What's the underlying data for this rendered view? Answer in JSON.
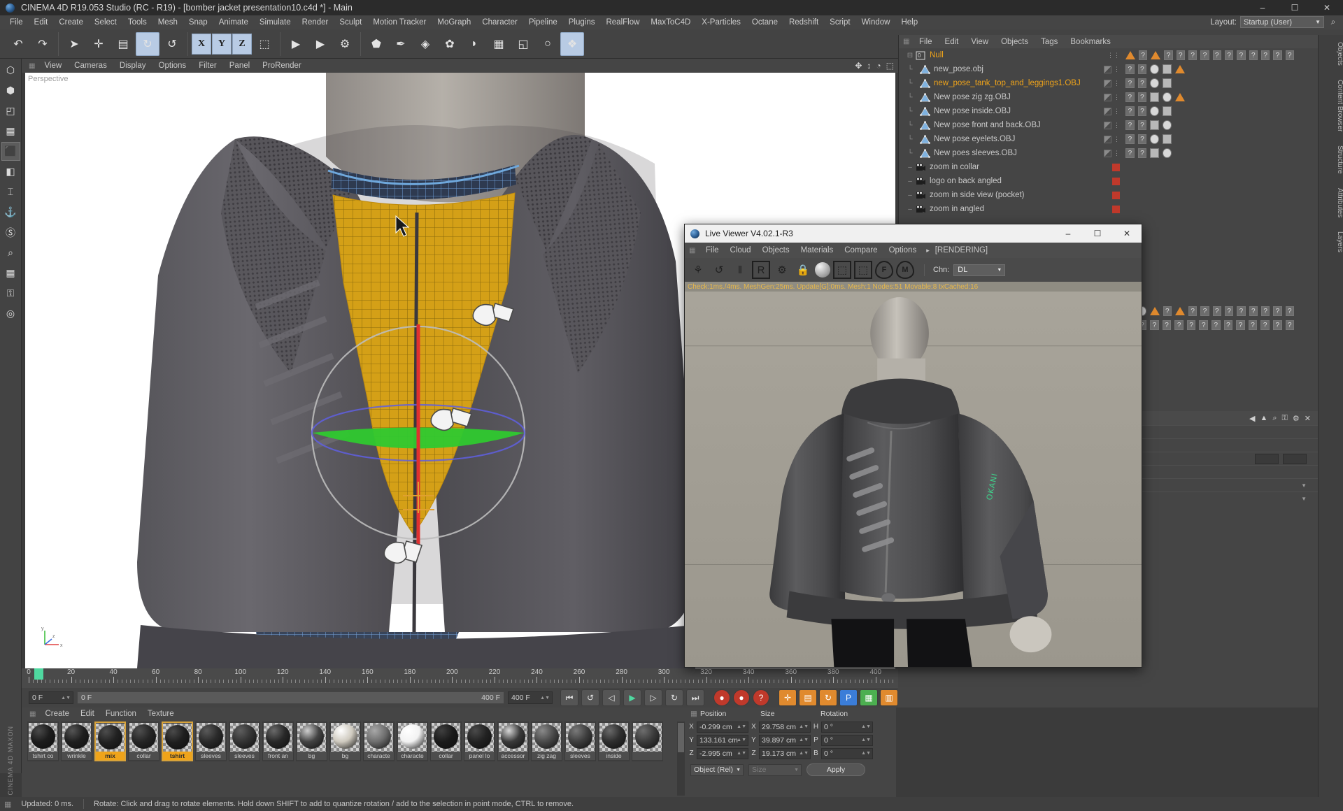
{
  "window": {
    "title": "CINEMA 4D R19.053 Studio (RC - R19) - [bomber jacket presentation10.c4d *] - Main",
    "minimize": "–",
    "maximize": "☐",
    "close": "✕"
  },
  "menubar": {
    "items": [
      "File",
      "Edit",
      "Create",
      "Select",
      "Tools",
      "Mesh",
      "Snap",
      "Animate",
      "Simulate",
      "Render",
      "Sculpt",
      "Motion Tracker",
      "MoGraph",
      "Character",
      "Pipeline",
      "Plugins",
      "RealFlow",
      "MaxToC4D",
      "X-Particles",
      "Octane",
      "Redshift",
      "Script",
      "Window",
      "Help"
    ],
    "layout_label": "Layout:",
    "layout_value": "Startup (User)",
    "search_icon": "search-icon"
  },
  "toolbar": {
    "groups": [
      {
        "name": "undo-redo",
        "buttons": [
          {
            "name": "undo-button",
            "glyph": "↶",
            "state": "off"
          },
          {
            "name": "redo-button",
            "glyph": "↷",
            "state": "off"
          }
        ]
      },
      {
        "name": "transform-tools",
        "buttons": [
          {
            "name": "select-tool",
            "glyph": "➤",
            "state": "off"
          },
          {
            "name": "move-tool",
            "glyph": "✛",
            "state": "off"
          },
          {
            "name": "scale-tool",
            "glyph": "▤",
            "state": "off"
          },
          {
            "name": "rotate-tool",
            "glyph": "↻",
            "state": "on"
          },
          {
            "name": "rotate-alt-tool",
            "glyph": "↺",
            "state": "off"
          }
        ]
      },
      {
        "name": "axis-locks",
        "buttons": [
          {
            "name": "lock-x-axis",
            "glyph": "X",
            "state": "axis"
          },
          {
            "name": "lock-y-axis",
            "glyph": "Y",
            "state": "axis"
          },
          {
            "name": "lock-z-axis",
            "glyph": "Z",
            "state": "axis"
          },
          {
            "name": "world-object-coords",
            "glyph": "⬚",
            "state": "off"
          }
        ]
      },
      {
        "name": "render-tools",
        "buttons": [
          {
            "name": "render-view-button",
            "glyph": "▶",
            "state": "off"
          },
          {
            "name": "render-region-button",
            "glyph": "▶",
            "state": "off"
          },
          {
            "name": "render-settings-button",
            "glyph": "⚙",
            "state": "off"
          }
        ]
      },
      {
        "name": "object-creation",
        "buttons": [
          {
            "name": "add-cube-button",
            "glyph": "⬟",
            "state": "off"
          },
          {
            "name": "add-spline-button",
            "glyph": "✒",
            "state": "off"
          },
          {
            "name": "add-generator-button",
            "glyph": "◈",
            "state": "off"
          },
          {
            "name": "add-deformer-button",
            "glyph": "✿",
            "state": "off"
          },
          {
            "name": "add-environment-button",
            "glyph": "◗",
            "state": "off"
          },
          {
            "name": "add-scene-button",
            "glyph": "▦",
            "state": "off"
          },
          {
            "name": "add-camera-button",
            "glyph": "◱",
            "state": "off"
          },
          {
            "name": "add-light-button",
            "glyph": "○",
            "state": "off"
          },
          {
            "name": "add-mograph-button",
            "glyph": "❖",
            "state": "on"
          }
        ]
      }
    ]
  },
  "leftbar": {
    "items": [
      {
        "name": "live-selection-tool",
        "glyph": "⬡",
        "selected": false
      },
      {
        "name": "point-mode-tool",
        "glyph": "⬢",
        "selected": false
      },
      {
        "name": "edge-mode-tool",
        "glyph": "◰",
        "selected": false
      },
      {
        "name": "polygon-mode-tool",
        "glyph": "▦",
        "selected": false
      },
      {
        "name": "model-mode-tool",
        "glyph": "⬛",
        "selected": true
      },
      {
        "name": "texture-mode-tool",
        "glyph": "◧",
        "selected": false
      },
      {
        "name": "workplane-tool",
        "glyph": "⌶",
        "selected": false
      },
      {
        "name": "axis-lock-tool",
        "glyph": "⚓",
        "selected": false
      },
      {
        "name": "snap-tool",
        "glyph": "Ⓢ",
        "selected": false
      },
      {
        "name": "magnet-tool",
        "glyph": "⌕",
        "selected": false
      },
      {
        "name": "uv-mesh-tool",
        "glyph": "▦",
        "selected": false
      },
      {
        "name": "lock-tool",
        "glyph": "⚿",
        "selected": false
      },
      {
        "name": "viewport-solo-tool",
        "glyph": "◎",
        "selected": false
      }
    ]
  },
  "viewport": {
    "menu": [
      "View",
      "Cameras",
      "Display",
      "Options",
      "Filter",
      "Panel",
      "ProRender"
    ],
    "icons": [
      {
        "name": "pan-view-icon",
        "glyph": "✥"
      },
      {
        "name": "dolly-view-icon",
        "glyph": "↕"
      },
      {
        "name": "rotate-view-icon",
        "glyph": "◔"
      },
      {
        "name": "maximize-view-icon",
        "glyph": "⬚"
      }
    ],
    "label": "Perspective",
    "axis_gizmo": {
      "x": "x",
      "y": "y",
      "z": "z"
    }
  },
  "timeline": {
    "ticks_major": [
      0,
      20,
      40,
      60,
      80,
      100,
      120,
      140,
      160,
      180,
      200,
      220,
      240,
      260,
      280,
      300,
      320,
      340,
      360,
      380,
      400
    ],
    "current_frame_label": "0 F",
    "start_field": "0 F",
    "range_start": "0 F",
    "range_end": "400 F",
    "end_field": "400 F",
    "transport": [
      {
        "name": "go-to-start-button",
        "glyph": "⏮"
      },
      {
        "name": "play-backwards-button",
        "glyph": "↺"
      },
      {
        "name": "previous-frame-button",
        "glyph": "◁"
      },
      {
        "name": "play-button",
        "glyph": "▶"
      },
      {
        "name": "next-frame-button",
        "glyph": "▷"
      },
      {
        "name": "loop-button",
        "glyph": "↻"
      },
      {
        "name": "go-to-end-button",
        "glyph": "⏭"
      }
    ],
    "record_buttons": [
      {
        "name": "record-active-objects-button",
        "glyph": "●",
        "color": "#c0392b"
      },
      {
        "name": "autokeying-button",
        "glyph": "●",
        "color": "#c0392b"
      },
      {
        "name": "keyframe-selection-button",
        "glyph": "?",
        "color": "#c0392b"
      }
    ],
    "key_toggles": [
      {
        "name": "position-key-toggle",
        "glyph": "✛",
        "color": "#e08a2e"
      },
      {
        "name": "scale-key-toggle",
        "glyph": "▤",
        "color": "#e08a2e"
      },
      {
        "name": "rotation-key-toggle",
        "glyph": "↻",
        "color": "#e08a2e"
      },
      {
        "name": "parameter-key-toggle",
        "glyph": "P",
        "color": "#3b7dd8"
      },
      {
        "name": "point-level-animation-toggle",
        "glyph": "▦",
        "color": "#4caf50"
      },
      {
        "name": "timeline-mode-toggle",
        "glyph": "▥",
        "color": "#e08a2e"
      }
    ]
  },
  "material_manager": {
    "menu": [
      "Create",
      "Edit",
      "Function",
      "Texture"
    ],
    "materials": [
      {
        "name": "tshirt co",
        "color": "#1c1c1c",
        "highlight": "#4a4a4a",
        "selected": false
      },
      {
        "name": "wrinkle",
        "color": "#1f1f1f",
        "highlight": "#555",
        "selected": false
      },
      {
        "name": "mix",
        "color": "#212121",
        "highlight": "#4d4d4d",
        "selected": true
      },
      {
        "name": "collar",
        "color": "#252525",
        "highlight": "#4f4f4f",
        "selected": false
      },
      {
        "name": "tshirt",
        "color": "#1e1e1e",
        "highlight": "#4a4a4a",
        "selected": true
      },
      {
        "name": "sleeves",
        "color": "#2a2a2a",
        "highlight": "#5a5a5a",
        "selected": false
      },
      {
        "name": "sleeves",
        "color": "#333333",
        "highlight": "#5e5e5e",
        "selected": false
      },
      {
        "name": "front an",
        "color": "#282828",
        "highlight": "#6a6a6a",
        "selected": false
      },
      {
        "name": "bg",
        "color": "#444444",
        "highlight": "#cfcfcf",
        "selected": false
      },
      {
        "name": "bg",
        "color": "#cfcabf",
        "highlight": "#ffffff",
        "selected": false
      },
      {
        "name": "characte",
        "color": "#6e6e6e",
        "highlight": "#a8a8a8",
        "selected": false
      },
      {
        "name": "characte",
        "color": "#f2f2f2",
        "highlight": "#ffffff",
        "selected": false
      },
      {
        "name": "collar",
        "color": "#1a1a1a",
        "highlight": "#3f3f3f",
        "selected": false
      },
      {
        "name": "panel lo",
        "color": "#222222",
        "highlight": "#4a4a4a",
        "selected": false
      },
      {
        "name": "accessor",
        "color": "#3a3a3a",
        "highlight": "#d8d8d8",
        "selected": false
      },
      {
        "name": "zig zag",
        "color": "#4a4a4a",
        "highlight": "#8a8a8a",
        "selected": false
      },
      {
        "name": "sleeves",
        "color": "#3e3e3e",
        "highlight": "#7a7a7a",
        "selected": false
      },
      {
        "name": "inside",
        "color": "#2e2e2e",
        "highlight": "#6a6a6a",
        "selected": false
      },
      {
        "name": "",
        "color": "#3a3a3a",
        "highlight": "#6e6e6e",
        "selected": false
      }
    ]
  },
  "coordinates": {
    "headers": {
      "position": "Position",
      "size": "Size",
      "rotation": "Rotation"
    },
    "rows": [
      {
        "axis": "X",
        "position": "-0.299 cm",
        "size_axis": "X",
        "size": "29.758 cm",
        "rot_axis": "H",
        "rotation": "0 °"
      },
      {
        "axis": "Y",
        "position": "133.161 cm",
        "size_axis": "Y",
        "size": "39.897 cm",
        "rot_axis": "P",
        "rotation": "0 °"
      },
      {
        "axis": "Z",
        "position": "-2.995 cm",
        "size_axis": "Z",
        "size": "19.173 cm",
        "rot_axis": "B",
        "rotation": "0 °"
      }
    ],
    "mode_dropdown": "Object (Rel)",
    "size_dropdown": "Size",
    "apply_button": "Apply"
  },
  "object_manager": {
    "menu": [
      "File",
      "Edit",
      "View",
      "Objects",
      "Tags",
      "Bookmarks"
    ],
    "items": [
      {
        "label": "Null",
        "icon": "null-icon",
        "selected": true,
        "indent": 0,
        "type": "null"
      },
      {
        "label": "new_pose.obj",
        "icon": "polygon-object-icon",
        "selected": false,
        "indent": 1,
        "type": "obj"
      },
      {
        "label": "new_pose_tank_top_and_leggings1.OBJ",
        "icon": "polygon-object-icon",
        "selected": true,
        "indent": 1,
        "type": "obj"
      },
      {
        "label": "New pose zig zg.OBJ",
        "icon": "polygon-object-icon",
        "selected": false,
        "indent": 1,
        "type": "obj"
      },
      {
        "label": "New pose inside.OBJ",
        "icon": "polygon-object-icon",
        "selected": false,
        "indent": 1,
        "type": "obj"
      },
      {
        "label": "New pose front and back.OBJ",
        "icon": "polygon-object-icon",
        "selected": false,
        "indent": 1,
        "type": "obj"
      },
      {
        "label": "New pose eyelets.OBJ",
        "icon": "polygon-object-icon",
        "selected": false,
        "indent": 1,
        "type": "obj"
      },
      {
        "label": "New poes sleeves.OBJ",
        "icon": "polygon-object-icon",
        "selected": false,
        "indent": 1,
        "type": "obj"
      },
      {
        "label": "zoom in collar",
        "icon": "camera-icon",
        "selected": false,
        "indent": 0,
        "type": "camera"
      },
      {
        "label": "logo on back angled",
        "icon": "camera-icon",
        "selected": false,
        "indent": 0,
        "type": "camera"
      },
      {
        "label": "zoom in side view (pocket)",
        "icon": "camera-icon",
        "selected": false,
        "indent": 0,
        "type": "camera"
      },
      {
        "label": "zoom in angled",
        "icon": "camera-icon",
        "selected": false,
        "indent": 0,
        "type": "camera"
      }
    ]
  },
  "live_viewer": {
    "title": "Live Viewer V4.02.1-R3",
    "window_buttons": {
      "minimize": "–",
      "maximize": "☐",
      "close": "✕"
    },
    "menu": [
      "File",
      "Cloud",
      "Objects",
      "Materials",
      "Compare",
      "Options"
    ],
    "menu_arrow": "▸",
    "rendering_state": "[RENDERING]",
    "tools": [
      {
        "name": "restart-render-icon",
        "glyph": "⚘"
      },
      {
        "name": "refresh-icon",
        "glyph": "↺"
      },
      {
        "name": "pause-icon",
        "glyph": "‖"
      },
      {
        "name": "region-render-icon",
        "glyph": "R"
      },
      {
        "name": "settings-gear-icon",
        "glyph": "⚙"
      },
      {
        "name": "lock-icon",
        "glyph": "ὑ2"
      },
      {
        "name": "material-preview-icon",
        "glyph": "◑"
      },
      {
        "name": "save-image-icon",
        "glyph": "⬚"
      },
      {
        "name": "save-region-icon",
        "glyph": "⬚"
      },
      {
        "name": "focus-picker-icon",
        "glyph": "F"
      },
      {
        "name": "material-picker-icon",
        "glyph": "M"
      }
    ],
    "channel_label": "Chn:",
    "channel_value": "DL",
    "status": "Check:1ms./4ms. MeshGen:25ms. Update[G]:0ms. Mesh:1 Nodes:51 Movable:8 txCached:16"
  },
  "attributes_panel": {
    "icons": [
      {
        "name": "nav-back-icon",
        "glyph": "◀"
      },
      {
        "name": "nav-up-icon",
        "glyph": "▲"
      },
      {
        "name": "search-attr-icon",
        "glyph": "⌕"
      },
      {
        "name": "lock-attr-icon",
        "glyph": "⚿"
      },
      {
        "name": "options-attr-icon",
        "glyph": "⚙"
      },
      {
        "name": "close-attr-icon",
        "glyph": "✕"
      }
    ]
  },
  "right_tabs": [
    {
      "name": "objects-tab",
      "label": "Objects"
    },
    {
      "name": "content-browser-tab",
      "label": "Content Browser"
    },
    {
      "name": "structure-tab",
      "label": "Structure"
    },
    {
      "name": "attributes-tab",
      "label": "Attributes"
    },
    {
      "name": "layers-tab",
      "label": "Layers"
    }
  ],
  "statusbar": {
    "left": "Updated: 0 ms.",
    "message": "Rotate: Click and drag to rotate elements. Hold down SHIFT to add to quantize rotation / add to the selection in point mode, CTRL to remove."
  },
  "branding": {
    "maxon": "MAXON",
    "cinema4d": "CINEMA 4D"
  },
  "colors": {
    "accent_orange": "#f0a41a",
    "selection_blue": "#b8cbe4",
    "mesh_orange": "#d4a017",
    "panel_bg": "#454545",
    "viewport_white": "#ffffff",
    "axis_red": "#e03030",
    "axis_green": "#30c030",
    "axis_blue": "#3050e0"
  }
}
